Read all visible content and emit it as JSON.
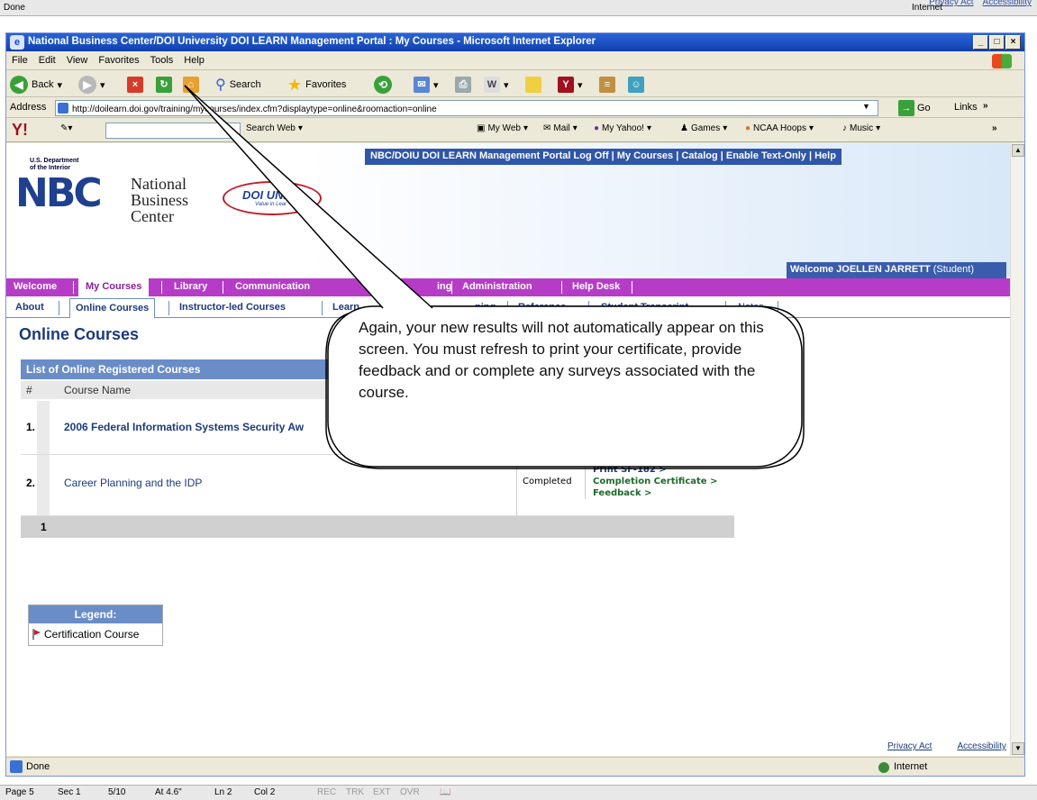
{
  "background_window": {
    "status": "Done",
    "zone": "Internet",
    "links": [
      "Privacy Act",
      "Accessibility"
    ]
  },
  "browser": {
    "title": "National Business Center/DOI University DOI LEARN Management Portal : My Courses - Microsoft Internet Explorer",
    "menu": [
      "File",
      "Edit",
      "View",
      "Favorites",
      "Tools",
      "Help"
    ],
    "toolbar": {
      "back": "Back",
      "search": "Search",
      "favorites": "Favorites"
    },
    "address_label": "Address",
    "address_url": "http://doilearn.doi.gov/training/mycourses/index.cfm?displaytype=online&roomaction=online",
    "go_label": "Go",
    "links_label": "Links",
    "yahoo_toolbar": {
      "search_web": "Search Web",
      "items": [
        "My Web",
        "Mail",
        "My Yahoo!",
        "Games",
        "NCAA Hoops",
        "Music"
      ]
    },
    "status_text": "Done",
    "status_zone": "Internet"
  },
  "portal": {
    "doi_text": "U.S. Department of the Interior",
    "logo_text": "NBC",
    "nbc_name": [
      "National",
      "Business",
      "Center"
    ],
    "doiu_text": "DOI UNIV",
    "doiu_tagline": "Value in Lear",
    "top_nav": "NBC/DOIU DOI LEARN Management Portal Log Off  |  My Courses  |  Catalog  |  Enable Text-Only  |  Help",
    "welcome": "Welcome JOELLEN JARRETT",
    "welcome_role": "(Student)",
    "main_nav": [
      "Welcome",
      "My Courses",
      "Library",
      "Communication",
      "ing",
      "Administration",
      "Help Desk"
    ],
    "sub_nav": [
      "About",
      "Online Courses",
      "Instructor-led Courses",
      "Learn",
      "ning",
      "Reference",
      "Student Transcript",
      "Notes"
    ],
    "page_title": "Online Courses",
    "list_title": "List of Online Registered Courses",
    "columns": {
      "num": "#",
      "name": "Course Name"
    },
    "rows": [
      {
        "num": "1.",
        "name": "2006 Federal Information Systems Security Aw"
      },
      {
        "num": "2.",
        "name": "Career Planning and the IDP",
        "status": "Completed",
        "actions": [
          "Print SF-182 >",
          "Completion Certificate >",
          "Feedback >"
        ]
      }
    ],
    "pager": "1",
    "legend_title": "Legend:",
    "legend_item": "Certification Course",
    "footer_links": [
      "Privacy Act",
      "Accessibility"
    ]
  },
  "callout": {
    "text": "Again, your new results will not automatically appear on this screen.  You must refresh to print your certificate, provide feedback and or complete any surveys associated with the course."
  },
  "word_status": {
    "items": [
      "Page 5",
      "Sec 1",
      "5/10",
      "At 4.6\"",
      "Ln 2",
      "Col 2",
      "REC",
      "TRK",
      "EXT",
      "OVR"
    ]
  }
}
